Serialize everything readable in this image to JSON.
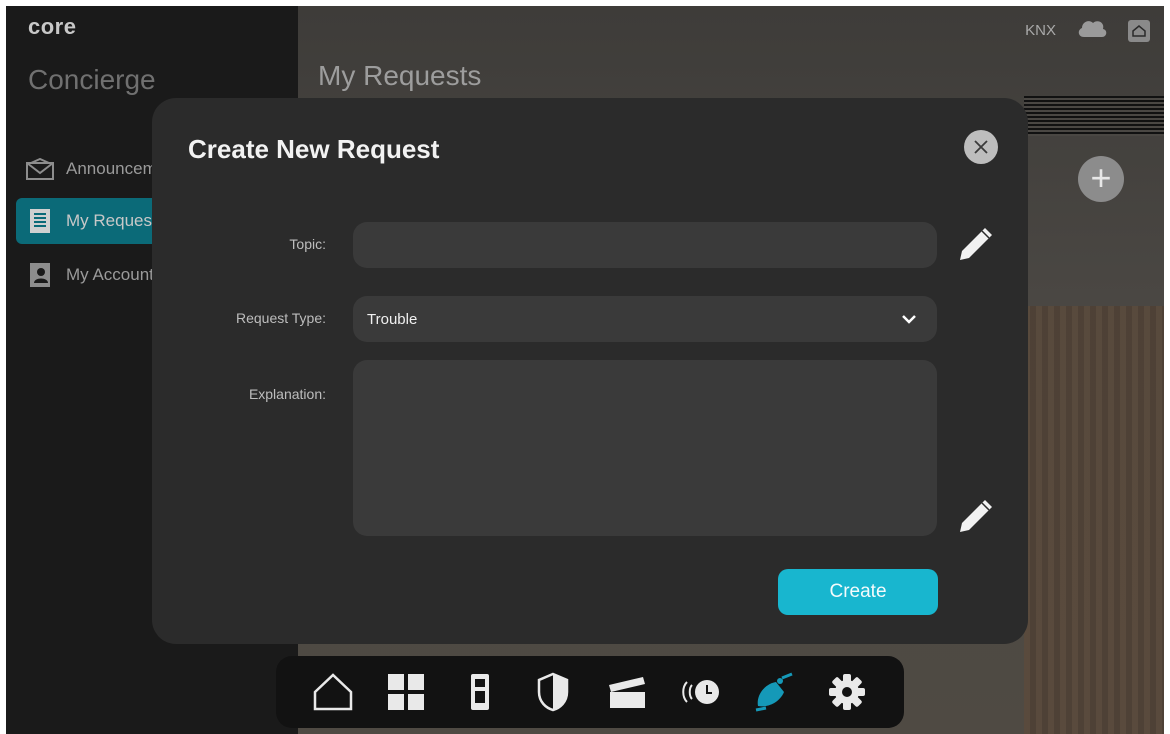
{
  "app": {
    "logo": "core"
  },
  "sidebar": {
    "title": "Concierge",
    "items": [
      {
        "label": "Announcements",
        "icon": "envelope-icon",
        "active": false
      },
      {
        "label": "My Requests",
        "icon": "list-icon",
        "active": true
      },
      {
        "label": "My Account",
        "icon": "contact-card-icon",
        "active": false
      }
    ]
  },
  "main": {
    "title": "My Requests"
  },
  "status": {
    "knx_label": "KNX"
  },
  "modal": {
    "title": "Create New Request",
    "topic": {
      "label": "Topic:",
      "value": ""
    },
    "request_type": {
      "label": "Request Type:",
      "value": "Trouble"
    },
    "explanation": {
      "label": "Explanation:",
      "value": ""
    },
    "create_label": "Create"
  },
  "bottom_nav": [
    {
      "name": "home-icon"
    },
    {
      "name": "grid-icon"
    },
    {
      "name": "intercom-icon"
    },
    {
      "name": "shield-icon"
    },
    {
      "name": "clapper-icon"
    },
    {
      "name": "schedule-icon"
    },
    {
      "name": "concierge-bell-icon",
      "active": true
    },
    {
      "name": "gear-icon"
    }
  ],
  "colors": {
    "accent": "#18b6cf",
    "modal_bg": "#2b2b2b",
    "field_bg": "#3a3a3a"
  }
}
